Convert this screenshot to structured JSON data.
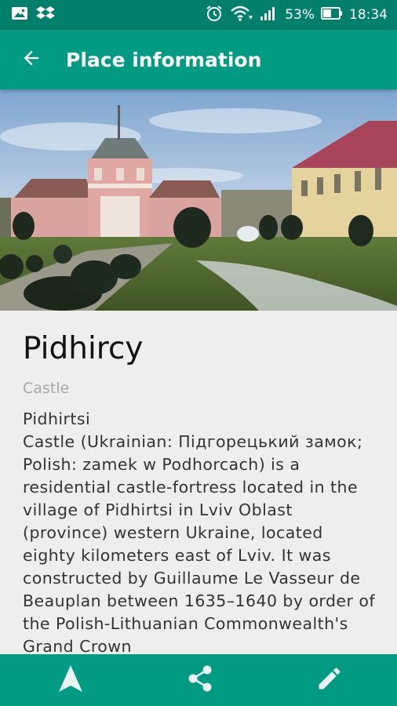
{
  "status_bar": {
    "battery": "53%",
    "time": "18:34",
    "icons": [
      "gallery-icon",
      "dropbox-icon",
      "alarm-icon",
      "wifi-icon",
      "signal-icon",
      "battery-icon"
    ]
  },
  "app_bar": {
    "title": "Place information",
    "back_icon": "back-arrow-icon"
  },
  "place": {
    "name": "Pidhircy",
    "category": "Castle",
    "description": "Pidhirtsi\nCastle (Ukrainian: Підгорецький замок; Polish: zamek w Podhorcach) is a residential castle-fortress located in the village of Pidhirtsi in Lviv Oblast (province) western Ukraine, located eighty kilometers east of Lviv. It was constructed by Guillaume Le Vasseur de Beauplan between 1635–1640 by order of the Polish-Lithuanian Commonwealth's Grand Crown"
  },
  "bottom_bar": {
    "actions": [
      "navigate-icon",
      "share-icon",
      "edit-icon"
    ]
  },
  "colors": {
    "status_bar": "#00806b",
    "primary": "#009b82",
    "background": "#eeeeee",
    "title_text": "#111111",
    "category_text": "#a8a8a8",
    "body_text": "#333333"
  }
}
